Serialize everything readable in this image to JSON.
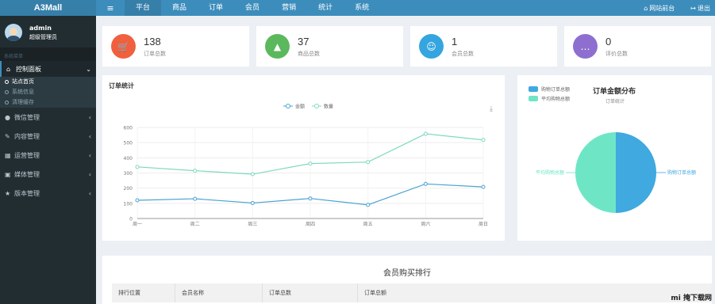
{
  "app": {
    "logo": "A3Mall"
  },
  "topnav": {
    "toggle": "≡",
    "items": [
      "平台",
      "商品",
      "订单",
      "会员",
      "营销",
      "统计",
      "系统"
    ],
    "right": {
      "site": "网站前台",
      "logout": "退出"
    }
  },
  "user": {
    "name": "admin",
    "role": "超级管理员"
  },
  "sidebar": {
    "section_label": "系统菜单",
    "dashboard": {
      "label": "控制面板",
      "children": [
        "站点首页",
        "系统信息",
        "清理缓存"
      ]
    },
    "items": [
      {
        "label": "微信管理",
        "icon": "wechat-icon"
      },
      {
        "label": "内容管理",
        "icon": "edit-icon"
      },
      {
        "label": "运营管理",
        "icon": "sitemap-icon"
      },
      {
        "label": "媒体管理",
        "icon": "image-icon"
      },
      {
        "label": "版本管理",
        "icon": "star-icon"
      }
    ]
  },
  "stats": [
    {
      "value": "138",
      "label": "订单总数",
      "color": "#f0603e",
      "icon": "cart-icon"
    },
    {
      "value": "37",
      "label": "商品总数",
      "color": "#5cb85c",
      "icon": "chart-area-icon"
    },
    {
      "value": "1",
      "label": "会员总数",
      "color": "#35a5e0",
      "icon": "user-icon"
    },
    {
      "value": "0",
      "label": "评价总数",
      "color": "#8e6fd0",
      "icon": "comment-icon"
    }
  ],
  "order_chart": {
    "title": "订单统计",
    "download_icon": "download-icon"
  },
  "pie_chart": {
    "title": "订单金额分布",
    "subtitle": "订单统计"
  },
  "ranking": {
    "title": "会员购买排行",
    "columns": [
      "排行位置",
      "会员名称",
      "订单总数",
      "订单总额"
    ]
  },
  "watermark": "mi 掩下载网",
  "chart_data": [
    {
      "type": "line",
      "x": [
        "周一",
        "周二",
        "周三",
        "周四",
        "周五",
        "周六",
        "周日"
      ],
      "series": [
        {
          "name": "金额",
          "values": [
            120,
            130,
            102,
            132,
            90,
            228,
            208
          ],
          "color": "#4aa3d0"
        },
        {
          "name": "数量",
          "values": [
            340,
            315,
            292,
            362,
            372,
            558,
            518
          ],
          "color": "#7fd9c0"
        }
      ],
      "yticks": [
        0,
        100,
        200,
        300,
        400,
        500,
        600
      ],
      "ylim": [
        0,
        600
      ],
      "legend": "top-center",
      "grid": true
    },
    {
      "type": "pie",
      "labels": [
        "购物订单总额",
        "平均购物总额"
      ],
      "values": [
        50,
        50
      ],
      "colors": [
        "#3fa9e0",
        "#6ee6c6"
      ],
      "legend": "top-left"
    }
  ]
}
